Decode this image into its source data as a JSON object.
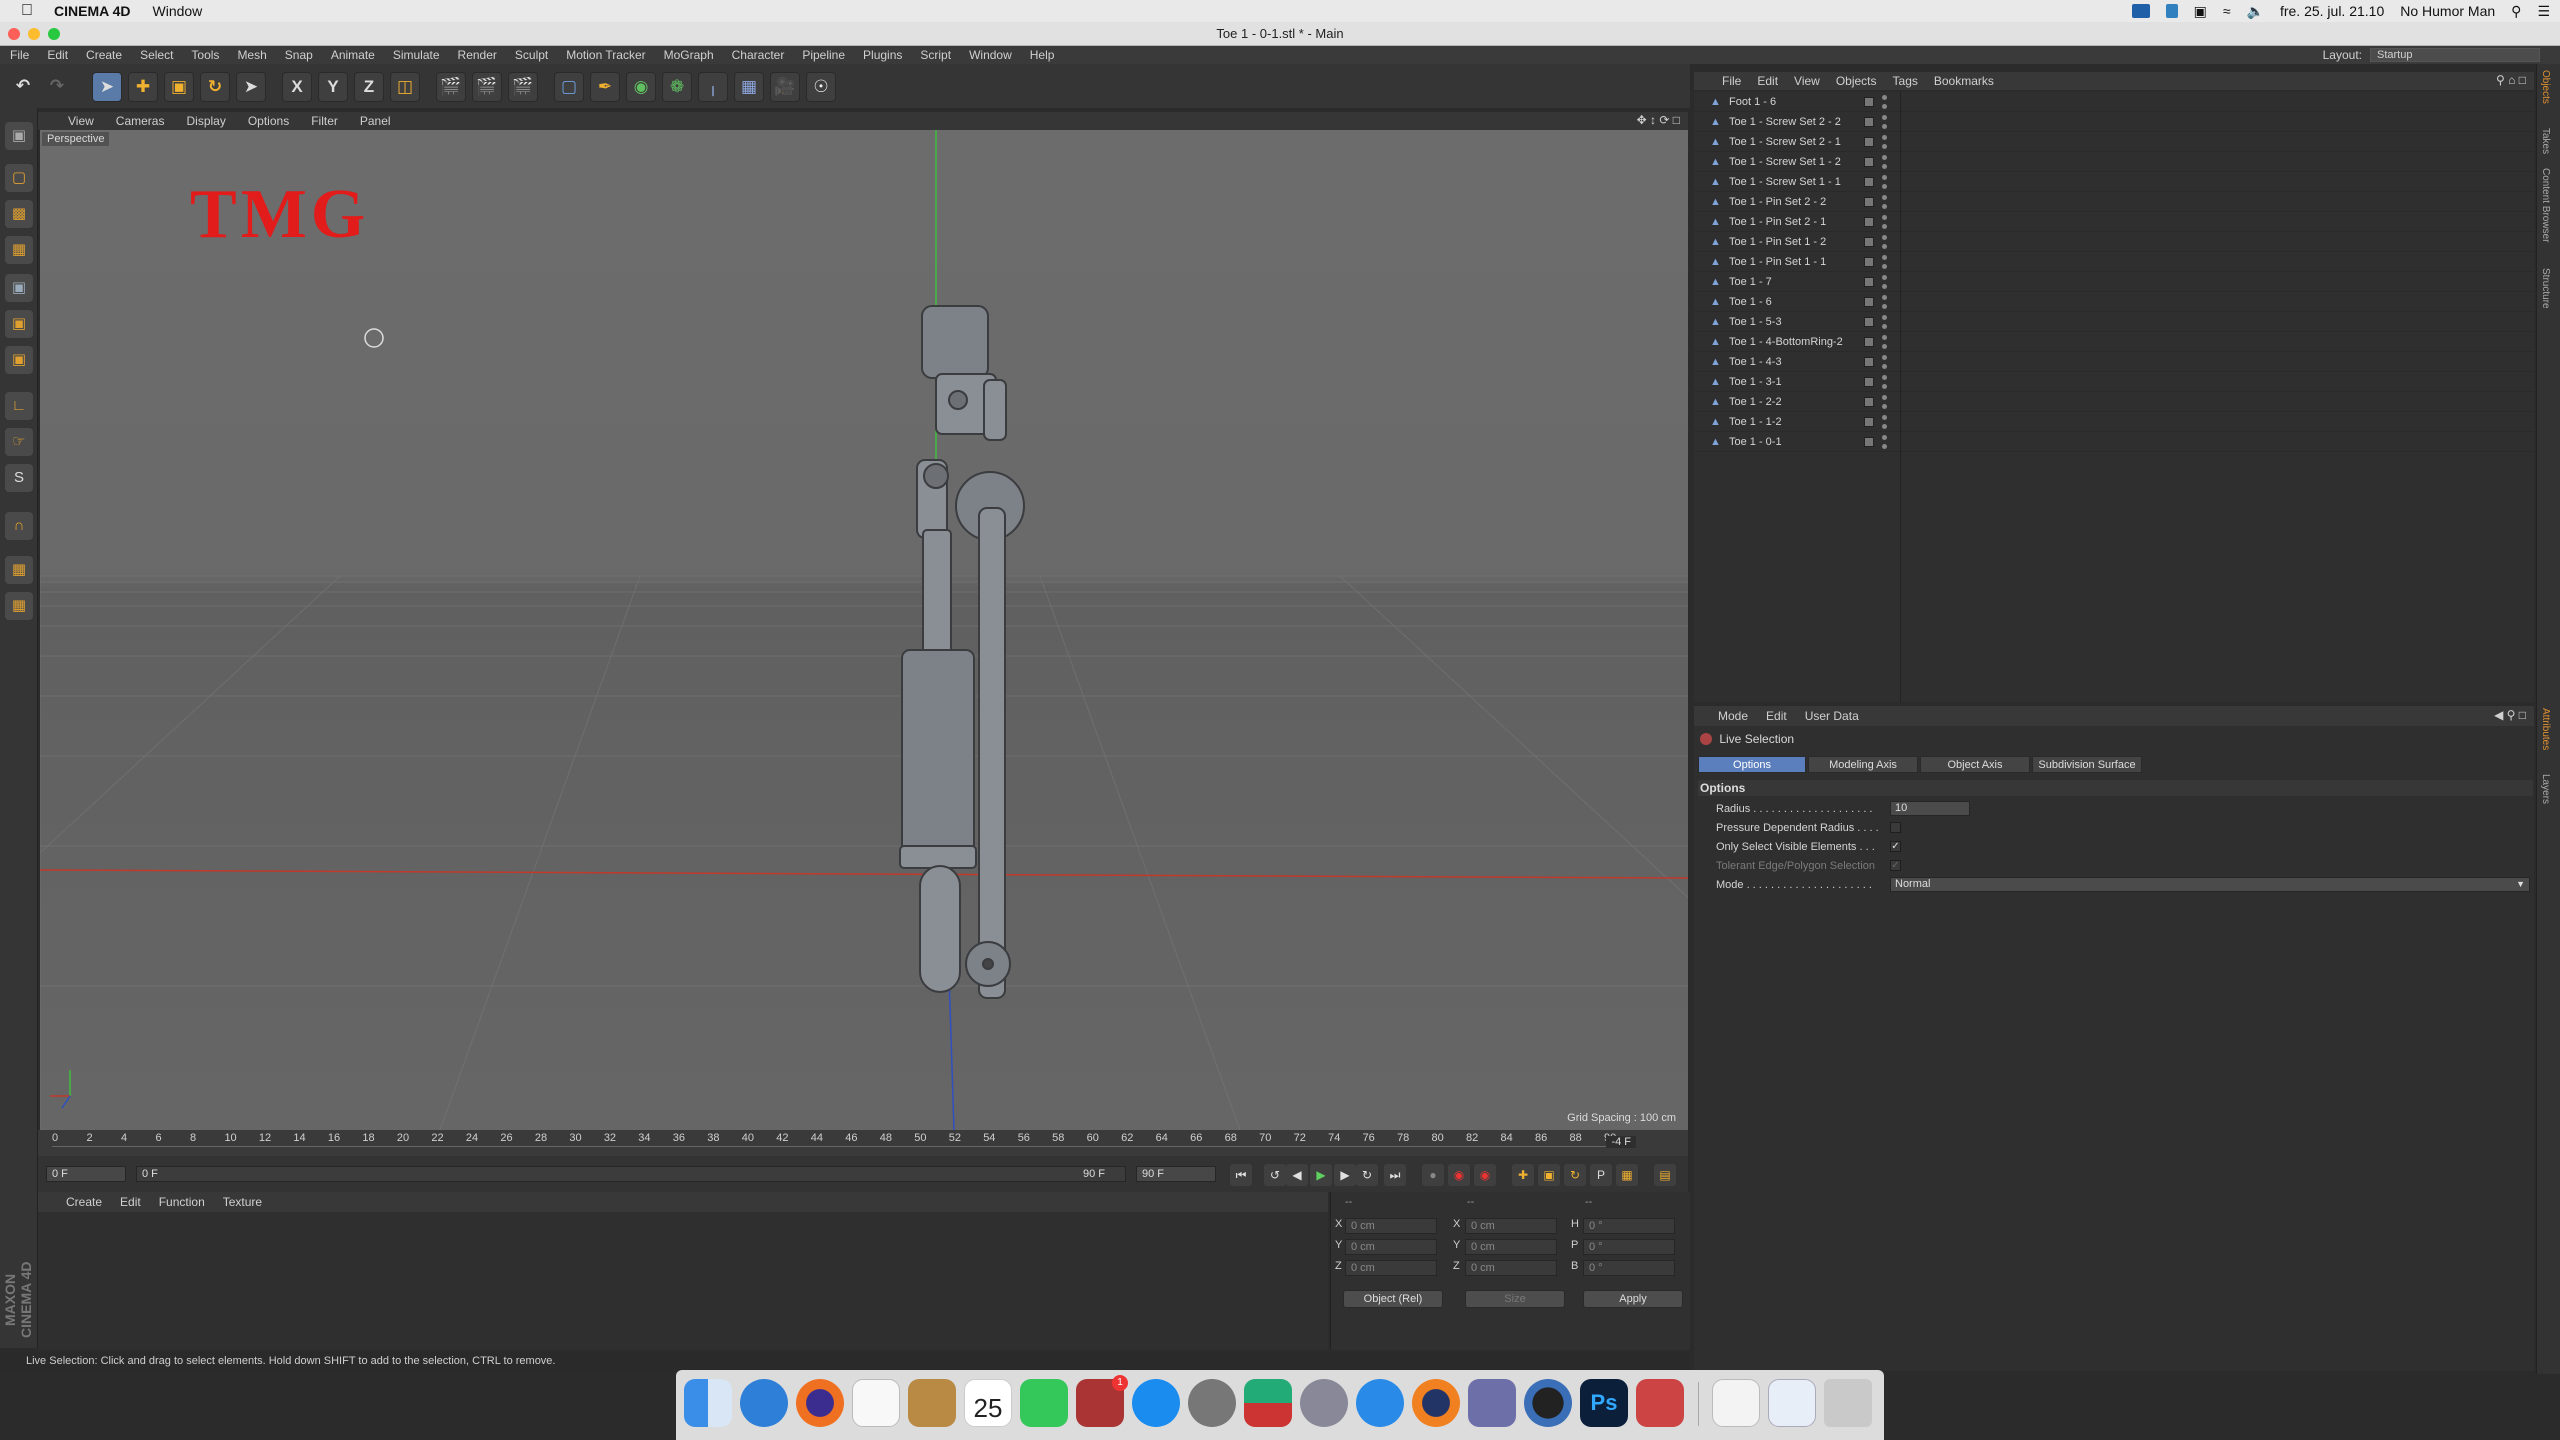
{
  "menubar": {
    "apple": "",
    "app": "CINEMA 4D",
    "items": [
      "Window"
    ],
    "datetime": "fre. 25. jul. 21.10",
    "user": "No Humor Man"
  },
  "window": {
    "title": "Toe 1 - 0-1.stl * - Main"
  },
  "app_menu": [
    "File",
    "Edit",
    "Create",
    "Select",
    "Tools",
    "Mesh",
    "Snap",
    "Animate",
    "Simulate",
    "Render",
    "Sculpt",
    "Motion Tracker",
    "MoGraph",
    "Character",
    "Pipeline",
    "Plugins",
    "Script",
    "Window",
    "Help"
  ],
  "layout": {
    "label": "Layout:",
    "value": "Startup"
  },
  "toolbar": {
    "x_label": "X",
    "y_label": "Y",
    "z_label": "Z"
  },
  "viewport": {
    "menu": [
      "View",
      "Cameras",
      "Display",
      "Options",
      "Filter",
      "Panel"
    ],
    "camera": "Perspective",
    "overlay_text": "TMG",
    "grid_spacing": "Grid Spacing : 100 cm"
  },
  "timeline": {
    "ticks": [
      "0",
      "2",
      "4",
      "6",
      "8",
      "10",
      "12",
      "14",
      "16",
      "18",
      "20",
      "22",
      "24",
      "26",
      "28",
      "30",
      "32",
      "34",
      "36",
      "38",
      "40",
      "42",
      "44",
      "46",
      "48",
      "50",
      "52",
      "54",
      "56",
      "58",
      "60",
      "62",
      "64",
      "66",
      "68",
      "70",
      "72",
      "74",
      "76",
      "78",
      "80",
      "82",
      "84",
      "86",
      "88",
      "90"
    ],
    "current_frame_badge": "-4 F",
    "start_field": "0 F",
    "range_start": "0 F",
    "range_end": "90 F",
    "end_field": "90 F"
  },
  "material_manager": {
    "menu": [
      "Create",
      "Edit",
      "Function",
      "Texture"
    ]
  },
  "coordinates": {
    "headers": [
      "--",
      "--",
      "--"
    ],
    "rows": [
      {
        "pos_label": "X",
        "pos": "0 cm",
        "size_label": "X",
        "size": "0 cm",
        "rot_label": "H",
        "rot": "0 °"
      },
      {
        "pos_label": "Y",
        "pos": "0 cm",
        "size_label": "Y",
        "size": "0 cm",
        "rot_label": "P",
        "rot": "0 °"
      },
      {
        "pos_label": "Z",
        "pos": "0 cm",
        "size_label": "Z",
        "size": "0 cm",
        "rot_label": "B",
        "rot": "0 °"
      }
    ],
    "mode": "Object (Rel)",
    "size_mode": "Size",
    "apply": "Apply"
  },
  "status_bar": "Live Selection: Click and drag to select elements. Hold down SHIFT to add to the selection, CTRL to remove.",
  "object_manager": {
    "menu": [
      "File",
      "Edit",
      "View",
      "Objects",
      "Tags",
      "Bookmarks"
    ],
    "objects": [
      "Foot 1 - 6",
      "Toe 1 - Screw Set 2 - 2",
      "Toe 1 - Screw Set 2 - 1",
      "Toe 1 - Screw Set 1 - 2",
      "Toe 1 - Screw Set 1 - 1",
      "Toe 1 - Pin Set 2 - 2",
      "Toe 1 - Pin Set 2 - 1",
      "Toe 1 - Pin Set 1 - 2",
      "Toe 1 - Pin Set 1 - 1",
      "Toe 1 - 7",
      "Toe 1 - 6",
      "Toe 1 - 5-3",
      "Toe 1 - 4-BottomRing-2",
      "Toe 1 - 4-3",
      "Toe 1 - 3-1",
      "Toe 1 - 2-2",
      "Toe 1 - 1-2",
      "Toe 1 - 0-1"
    ]
  },
  "attribute_manager": {
    "menu": [
      "Mode",
      "Edit",
      "User Data"
    ],
    "tool_name": "Live Selection",
    "tabs": [
      "Options",
      "Modeling Axis",
      "Object Axis",
      "Subdivision Surface"
    ],
    "section": "Options",
    "fields": {
      "radius_label": "Radius . . . . . . . . . . . . . . . . . . . .",
      "radius_value": "10",
      "pressure_label": "Pressure Dependent Radius . . . .",
      "visible_label": "Only Select Visible Elements . . .",
      "tolerant_label": "Tolerant Edge/Polygon Selection",
      "mode_label": "Mode . . . . . . . . . . . . . . . . . . . . .",
      "mode_value": "Normal"
    }
  },
  "right_tabs": [
    "Objects",
    "Takes",
    "Content Browser",
    "Structure",
    "Attributes",
    "Layers"
  ],
  "dock": {
    "calendar_day": "25",
    "badge": "1",
    "ps_label": "Ps"
  },
  "colors": {
    "accent": "#5b7fbd",
    "tmg_red": "#e21b1b",
    "viewport_bg": "#6a6a6a"
  }
}
